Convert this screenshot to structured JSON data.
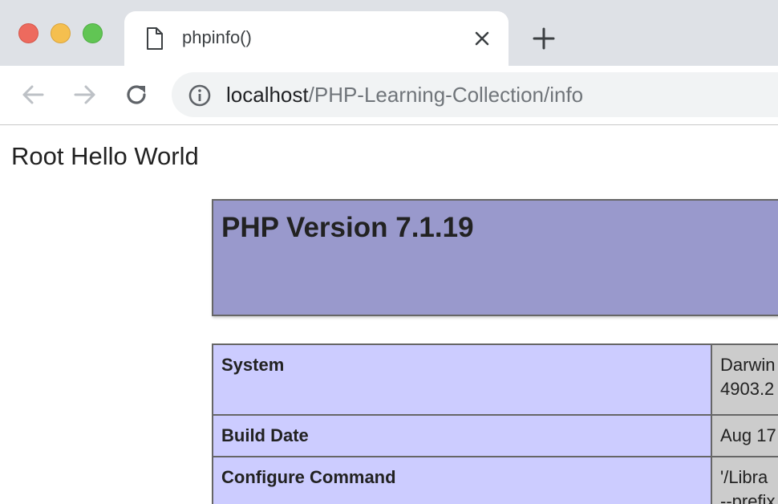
{
  "tab": {
    "title": "phpinfo()",
    "page_icon": "page-icon",
    "close_icon": "close-icon"
  },
  "new_tab_icon": "plus-icon",
  "toolbar": {
    "back_icon": "arrow-left-icon",
    "forward_icon": "arrow-right-icon",
    "reload_icon": "reload-icon",
    "info_icon": "info-circle-icon",
    "url_host": "localhost",
    "url_path": "/PHP-Learning-Collection/info"
  },
  "page": {
    "heading": "Root Hello World",
    "php_version": "PHP Version 7.1.19",
    "rows": [
      {
        "key": "System",
        "value": "Darwin\n4903.2"
      },
      {
        "key": "Build Date",
        "value": "Aug 17"
      },
      {
        "key": "Configure Command",
        "value": "'/Libra\n--prefix"
      }
    ]
  },
  "colors": {
    "traffic_close": "#ed6a5e",
    "traffic_minimize": "#f5bf4f",
    "traffic_maximize": "#61c554",
    "php_header_bg": "#9999cc",
    "php_key_bg": "#ccccff",
    "php_value_bg": "#cccccc"
  }
}
